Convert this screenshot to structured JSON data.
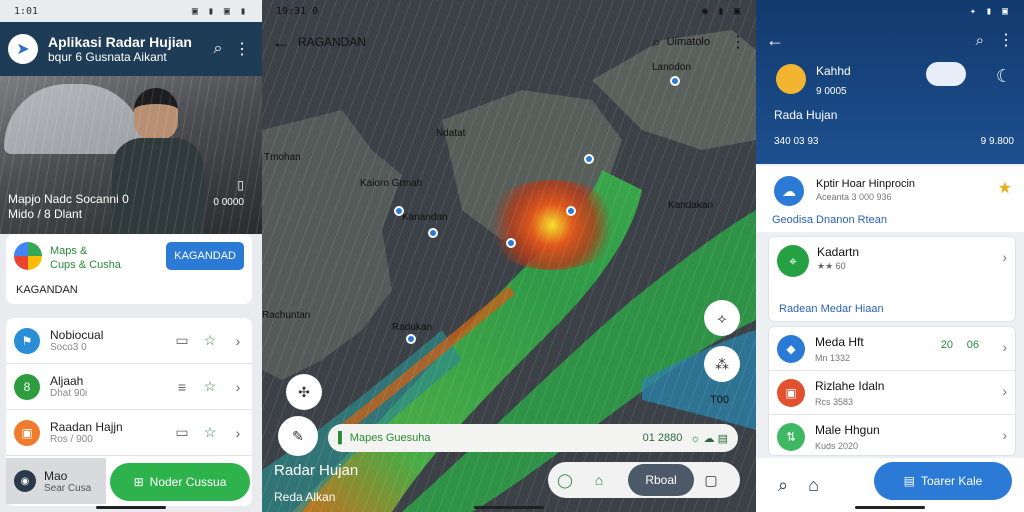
{
  "s1": {
    "status_time": "1:01",
    "status_icons": "▣ ▮ ▣ ▮",
    "title": "Aplikasi Radar Hujian",
    "subtitle": "bqur 6 Gusnata Aikant",
    "hero_line1": "Mapjo Nadc Socanni 0",
    "hero_line2": "Mido / 8 Dlant",
    "hero_meta": "0 0000",
    "card_line1": "Maps &",
    "card_line2": "Cups & Cusha",
    "card_button": "KAGANDAD",
    "card_footer": "KAGANDAN",
    "rows": [
      {
        "title": "Nobiocual",
        "sub": "Soco3 0",
        "color": "#2a8ed6",
        "icon": "⚑"
      },
      {
        "title": "Aljaah",
        "sub": "Dhat 90i",
        "color": "#2c9c3e",
        "icon": "8"
      },
      {
        "title": "Raadan Hajjn",
        "sub": "Ros / 900",
        "color": "#ef7b2c",
        "icon": "▣"
      }
    ],
    "last_title": "Mao",
    "last_sub": "Sear Cusa",
    "fab_label": "Noder Cussua"
  },
  "s2": {
    "status_time": "19:31 0",
    "status_icons": "◉ ▮ ▣",
    "map_title": "RAGANDAN",
    "search_hint": "Uimatolo",
    "labels": [
      {
        "text": "Uimatolo",
        "x": 0,
        "y": 0
      },
      {
        "text": "Lanodon",
        "x": 0,
        "y": 0
      }
    ],
    "places": [
      "Uimatolo",
      "Lanodon",
      "Ndatat",
      "Tmohan",
      "Kaioro Grmah",
      "Kanandan",
      "Rachuntan",
      "Radukan",
      "Kandakan"
    ],
    "search_label": "Mapes Guesuha",
    "search_value": "01 2880",
    "scale": "T00",
    "bottom_title": "Radar Hujan",
    "bottom_sub": "Reda Alkan",
    "seg_active": "Rboal"
  },
  "s3": {
    "status_time": "",
    "status_icons": "✦ ▮ ▣",
    "hdr_a": "Kahhd",
    "hdr_b": "9 0005",
    "hdr_title": "Rada Hujan",
    "hdr_foot": "340 03 93",
    "hdr_right": "9 9.800",
    "fav_title": "Kptir Hoar Hinprocin",
    "fav_sub": "Aceanta 3 000 936",
    "fav_link": "Geodisa Dnanon Rtean",
    "card_title": "Kadartn",
    "card_sub": "★★ 60",
    "card_link": "Radean Medar Hiaan",
    "rows": [
      {
        "title": "Meda Hft",
        "sub": "Mn 1332",
        "color": "#2a7ad6",
        "icon": "◆",
        "a1": "20",
        "a2": "06"
      },
      {
        "title": "Rizlahe Idaln",
        "sub": "Rcs 3583",
        "color": "#e2512f",
        "icon": "▣",
        "a1": "",
        "a2": ""
      },
      {
        "title": "Male Hhgun",
        "sub": "Kuds 2020",
        "color": "#3fb863",
        "icon": "⇅",
        "a1": "",
        "a2": ""
      }
    ],
    "cta_label": "Toarer Kale"
  }
}
